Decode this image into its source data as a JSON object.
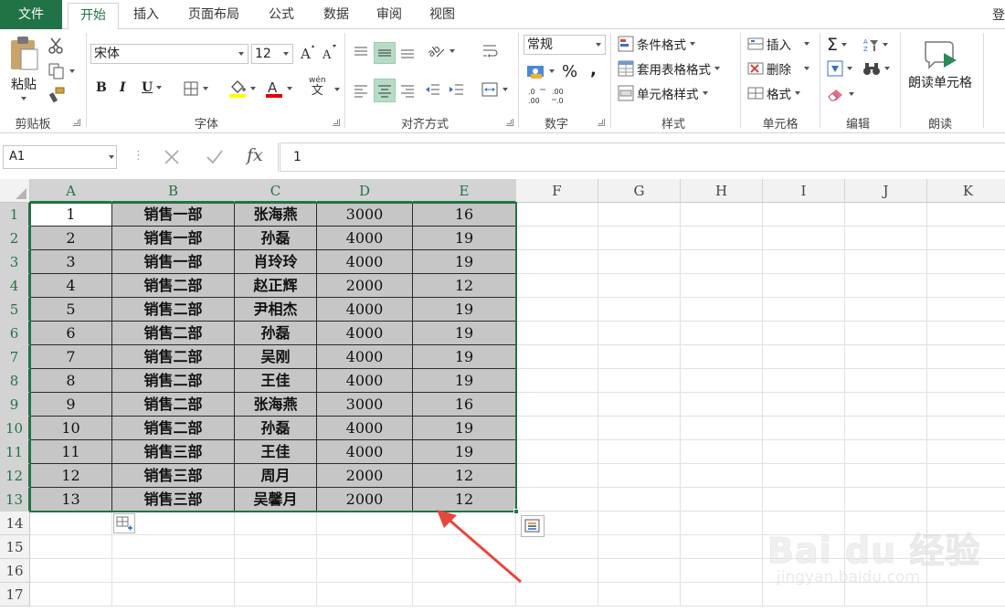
{
  "tabs": [
    "文件",
    "开始",
    "插入",
    "页面布局",
    "公式",
    "数据",
    "审阅",
    "视图"
  ],
  "active_tab": "开始",
  "login_label": "登",
  "ribbon": {
    "clipboard": {
      "paste": "粘贴",
      "label": "剪贴板"
    },
    "font": {
      "name": "宋体",
      "size": "12",
      "bold": "B",
      "italic": "I",
      "underline": "U",
      "label": "字体",
      "wen": "wén",
      "wen_char": "文"
    },
    "alignment": {
      "label": "对齐方式"
    },
    "number": {
      "format": "常规",
      "percent": "%",
      "comma": ",",
      "label": "数字"
    },
    "styles": {
      "conditional": "条件格式",
      "table": "套用表格格式",
      "cell_styles": "单元格样式",
      "label": "样式"
    },
    "cells": {
      "insert": "插入",
      "delete": "删除",
      "format": "格式",
      "label": "单元格"
    },
    "editing": {
      "label": "编辑"
    },
    "read": {
      "button": "朗读单元格",
      "label": "朗读"
    }
  },
  "formula_bar": {
    "name_box": "A1",
    "dots": "⋮",
    "fx": "fx",
    "value": "1"
  },
  "columns": [
    "A",
    "B",
    "C",
    "D",
    "E",
    "F",
    "G",
    "H",
    "I",
    "J",
    "K"
  ],
  "rows": [
    "1",
    "2",
    "3",
    "4",
    "5",
    "6",
    "7",
    "8",
    "9",
    "10",
    "11",
    "12",
    "13",
    "14",
    "15",
    "16",
    "17"
  ],
  "table": [
    [
      "1",
      "销售一部",
      "张海燕",
      "3000",
      "16"
    ],
    [
      "2",
      "销售一部",
      "孙磊",
      "4000",
      "19"
    ],
    [
      "3",
      "销售一部",
      "肖玲玲",
      "4000",
      "19"
    ],
    [
      "4",
      "销售二部",
      "赵正辉",
      "2000",
      "12"
    ],
    [
      "5",
      "销售二部",
      "尹相杰",
      "4000",
      "19"
    ],
    [
      "6",
      "销售二部",
      "孙磊",
      "4000",
      "19"
    ],
    [
      "7",
      "销售二部",
      "吴刚",
      "4000",
      "19"
    ],
    [
      "8",
      "销售二部",
      "王佳",
      "4000",
      "19"
    ],
    [
      "9",
      "销售二部",
      "张海燕",
      "3000",
      "16"
    ],
    [
      "10",
      "销售二部",
      "孙磊",
      "4000",
      "19"
    ],
    [
      "11",
      "销售三部",
      "王佳",
      "4000",
      "19"
    ],
    [
      "12",
      "销售三部",
      "周月",
      "2000",
      "12"
    ],
    [
      "13",
      "销售三部",
      "吴馨月",
      "2000",
      "12"
    ]
  ],
  "watermark": {
    "top": "Bai du 经验",
    "bottom": "jingyan.baidu.com"
  },
  "colors": {
    "accent": "#217346",
    "selection_fill": "#c6c6c6",
    "arrow": "#e8453c"
  }
}
